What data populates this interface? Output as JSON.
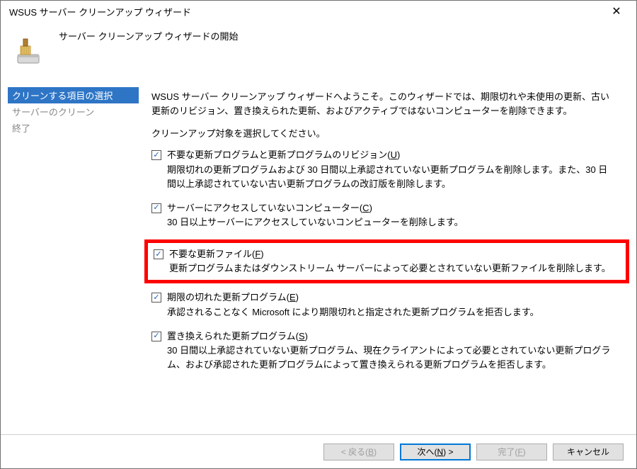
{
  "title": "WSUS サーバー クリーンアップ ウィザード",
  "header": {
    "subtitle": "サーバー クリーンアップ ウィザードの開始"
  },
  "sidebar": {
    "items": [
      {
        "label": "クリーンする項目の選択"
      },
      {
        "label": "サーバーのクリーン"
      },
      {
        "label": "終了"
      }
    ]
  },
  "main": {
    "intro": "WSUS サーバー クリーンアップ ウィザードへようこそ。このウィザードでは、期限切れや未使用の更新、古い更新のリビジョン、置き換えられた更新、およびアクティブではないコンピューターを削除できます。",
    "prompt": "クリーンアップ対象を選択してください。",
    "options": [
      {
        "label_pre": "不要な更新プログラムと更新プログラムのリビジョン(",
        "accel": "U",
        "label_post": ")",
        "desc": "期限切れの更新プログラムおよび 30 日間以上承認されていない更新プログラムを削除します。また、30 日間以上承認されていない古い更新プログラムの改訂版を削除します。"
      },
      {
        "label_pre": "サーバーにアクセスしていないコンピューター(",
        "accel": "C",
        "label_post": ")",
        "desc": "30 日以上サーバーにアクセスしていないコンピューターを削除します。"
      },
      {
        "label_pre": "不要な更新ファイル(",
        "accel": "F",
        "label_post": ")",
        "desc": "更新プログラムまたはダウンストリーム サーバーによって必要とされていない更新ファイルを削除します。"
      },
      {
        "label_pre": "期限の切れた更新プログラム(",
        "accel": "E",
        "label_post": ")",
        "desc": "承認されることなく Microsoft により期限切れと指定された更新プログラムを拒否します。"
      },
      {
        "label_pre": "置き換えられた更新プログラム(",
        "accel": "S",
        "label_post": ")",
        "desc": "30 日間以上承認されていない更新プログラム、現在クライアントによって必要とされていない更新プログラム、および承認された更新プログラムによって置き換えられる更新プログラムを拒否します。"
      }
    ]
  },
  "footer": {
    "back_pre": "< 戻る(",
    "back_a": "B",
    "back_post": ")",
    "next_pre": "次へ(",
    "next_a": "N",
    "next_post": ") >",
    "finish_pre": "完了(",
    "finish_a": "F",
    "finish_post": ")",
    "cancel": "キャンセル"
  },
  "icons": {
    "check": "✓",
    "close": "✕"
  }
}
